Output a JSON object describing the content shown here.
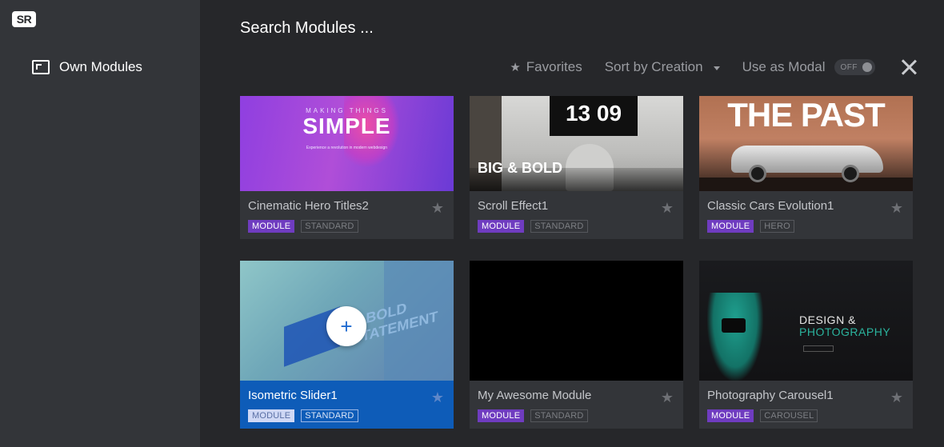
{
  "sidebar": {
    "logo": "SR",
    "items": [
      {
        "label": "Own Modules",
        "icon": "slider-window-icon"
      }
    ]
  },
  "search": {
    "placeholder": "Search Modules ..."
  },
  "toolbar": {
    "favorites_label": "Favorites",
    "sort_label": "Sort by Creation",
    "modal_label": "Use as Modal",
    "modal_toggle": "OFF"
  },
  "thumb_text": {
    "card1_small": "MAKING THINGS",
    "card1_big": "SIMPLE",
    "card1_sub": "Experience a revolution in modern webdesign",
    "card2_clock": "13 09",
    "card2_headline": "BIG & BOLD",
    "card3_headline": "THE PAST",
    "card4_word": "A BOLD STATEMENT",
    "card6_line1": "DESIGN &",
    "card6_line2": "PHOTOGRAPHY"
  },
  "modules": [
    {
      "title": "Cinematic Hero Titles2",
      "tag": "MODULE",
      "type": "STANDARD"
    },
    {
      "title": "Scroll Effect1",
      "tag": "MODULE",
      "type": "STANDARD"
    },
    {
      "title": "Classic Cars Evolution1",
      "tag": "MODULE",
      "type": "HERO"
    },
    {
      "title": "Isometric Slider1",
      "tag": "MODULE",
      "type": "STANDARD",
      "active": true
    },
    {
      "title": "My Awesome Module",
      "tag": "MODULE",
      "type": "STANDARD"
    },
    {
      "title": "Photography Carousel1",
      "tag": "MODULE",
      "type": "CAROUSEL"
    }
  ],
  "colors": {
    "background": "#26272a",
    "sidebar": "#333539",
    "card": "#333539",
    "active_card": "#0e5cb8",
    "module_tag": "#6f3cc0"
  }
}
